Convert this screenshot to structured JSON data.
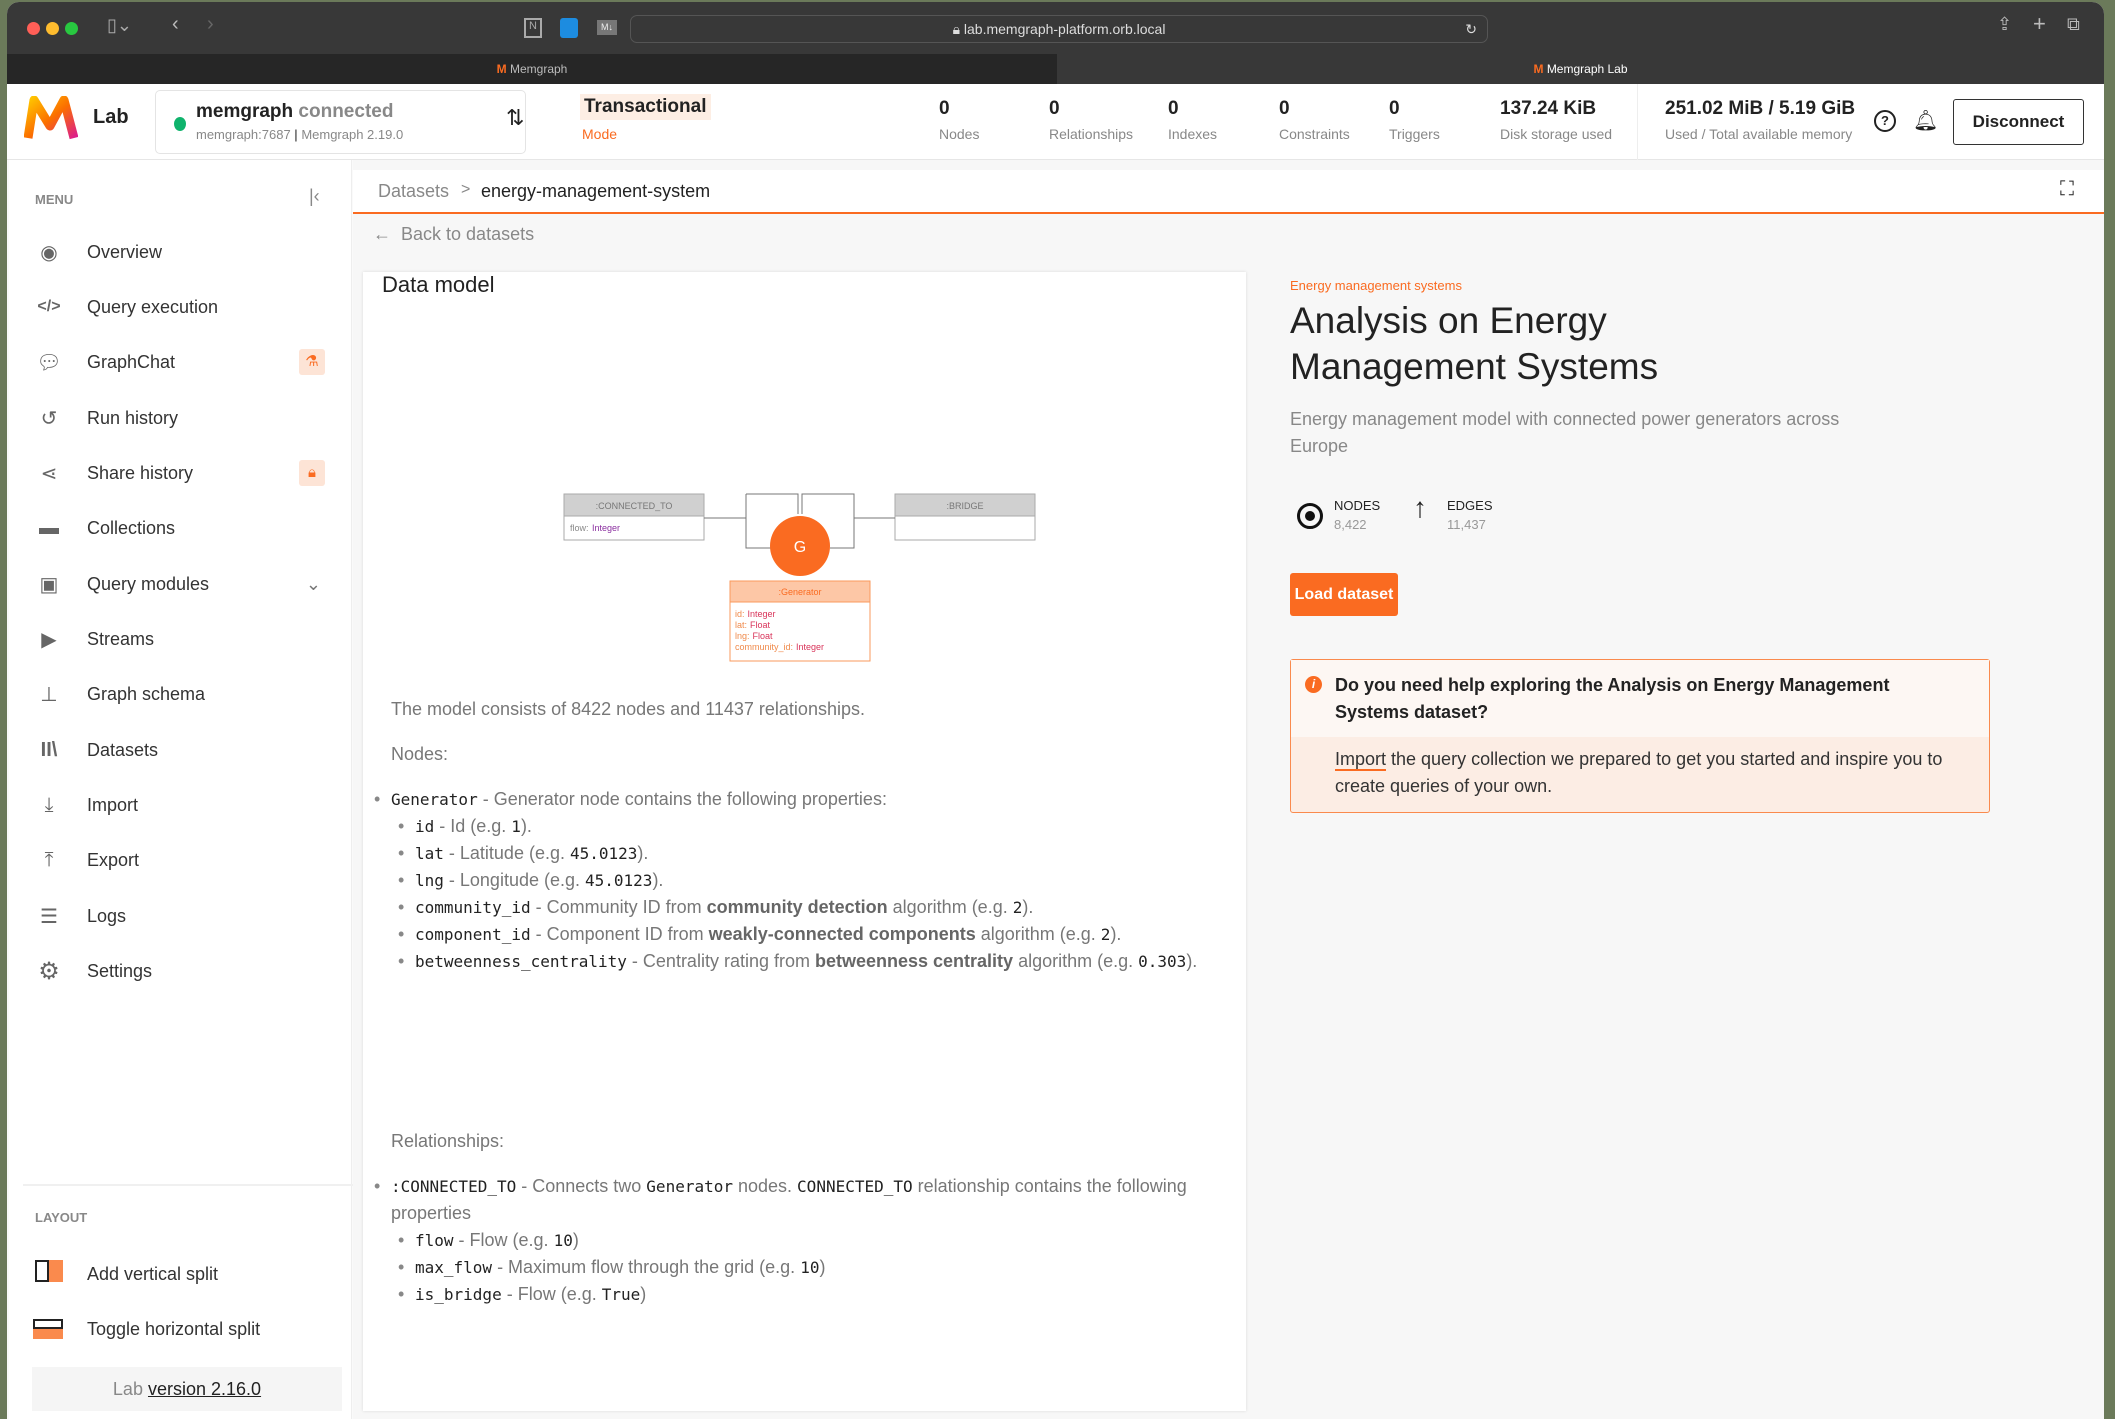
{
  "browser": {
    "url": "lab.memgraph-platform.orb.local",
    "tabs": [
      "Memgraph",
      "Memgraph Lab"
    ]
  },
  "header": {
    "logo_label": "Lab",
    "instance_name": "memgraph",
    "status": "connected",
    "host": "memgraph:7687",
    "version": "Memgraph 2.19.0",
    "mode_value": "Transactional",
    "mode_label": "Mode",
    "stats": [
      {
        "value": "0",
        "label": "Nodes"
      },
      {
        "value": "0",
        "label": "Relationships"
      },
      {
        "value": "0",
        "label": "Indexes"
      },
      {
        "value": "0",
        "label": "Constraints"
      },
      {
        "value": "0",
        "label": "Triggers"
      },
      {
        "value": "137.24 KiB",
        "label": "Disk storage used"
      },
      {
        "value": "251.02 MiB / 5.19 GiB",
        "label": "Used / Total available memory"
      }
    ],
    "disconnect_label": "Disconnect",
    "status_color": "#0fb36c"
  },
  "sidebar": {
    "menu_title": "MENU",
    "items": [
      {
        "label": "Overview",
        "icon": "eye-icon"
      },
      {
        "label": "Query execution",
        "icon": "code-icon"
      },
      {
        "label": "GraphChat",
        "icon": "chat-icon",
        "badge": "flask-icon"
      },
      {
        "label": "Run history",
        "icon": "history-icon"
      },
      {
        "label": "Share history",
        "icon": "share-icon",
        "badge": "lock-icon"
      },
      {
        "label": "Collections",
        "icon": "folder-icon"
      },
      {
        "label": "Query modules",
        "icon": "terminal-icon"
      },
      {
        "label": "Streams",
        "icon": "play-icon"
      },
      {
        "label": "Graph schema",
        "icon": "sitemap-icon"
      },
      {
        "label": "Datasets",
        "icon": "books-icon"
      },
      {
        "label": "Import",
        "icon": "download-icon"
      },
      {
        "label": "Export",
        "icon": "upload-icon"
      },
      {
        "label": "Logs",
        "icon": "list-icon"
      },
      {
        "label": "Settings",
        "icon": "gear-icon"
      }
    ],
    "layout_title": "LAYOUT",
    "layout_items": [
      "Add vertical split",
      "Toggle horizontal split"
    ],
    "version_prefix": "Lab",
    "version_link": "version 2.16.0"
  },
  "breadcrumb": {
    "root": "Datasets",
    "sep": ">",
    "current": "energy-management-system"
  },
  "back_label": "Back to datasets",
  "data_model": {
    "title": "Data model",
    "diagram": {
      "rel_box": ":CONNECTED_TO",
      "rel_prop": "flow:",
      "rel_type": "Integer",
      "bridge_box": ":BRIDGE",
      "node_letter": "G",
      "node_box": ":Generator",
      "node_props": [
        [
          "id:",
          "Integer"
        ],
        [
          "lat:",
          "Float"
        ],
        [
          "lng:",
          "Float"
        ],
        [
          "community_id:",
          "Integer"
        ]
      ]
    },
    "summary": "The model consists of 8422 nodes and 11437 relationships.",
    "nodes_heading": "Nodes:",
    "node": {
      "code": "Generator",
      "desc": " - Generator node contains the following properties:"
    },
    "node_props": [
      {
        "code": "id",
        "pre": " - Id (e.g. ",
        "ex": "1",
        "post": ")."
      },
      {
        "code": "lat",
        "pre": " - Latitude (e.g. ",
        "ex": "45.0123",
        "post": ")."
      },
      {
        "code": "lng",
        "pre": " - Longitude (e.g. ",
        "ex": "45.0123",
        "post": ")."
      },
      {
        "code": "community_id",
        "pre": " - Community ID from ",
        "bold": "community detection",
        "mid": " algorithm (e.g. ",
        "ex": "2",
        "post": ")."
      },
      {
        "code": "component_id",
        "pre": " - Component ID from ",
        "bold": "weakly-connected components",
        "mid": " algorithm (e.g. ",
        "ex": "2",
        "post": ")."
      },
      {
        "code": "betweenness_centrality",
        "pre": " - Centrality rating from ",
        "bold": "betweenness centrality",
        "mid": " algorithm (e.g. ",
        "ex": "0.303",
        "post": ")."
      }
    ],
    "rels_heading": "Relationships:",
    "rel": {
      "code": ":CONNECTED_TO",
      "d1": " - Connects two ",
      "code2": "Generator",
      "d2": " nodes. ",
      "code3": "CONNECTED_TO",
      "d3": " relationship contains the following properties"
    },
    "rel_props": [
      {
        "code": "flow",
        "pre": " - Flow (e.g. ",
        "ex": "10",
        "post": ")"
      },
      {
        "code": "max_flow",
        "pre": " - Maximum flow through the grid (e.g. ",
        "ex": "10",
        "post": ")"
      },
      {
        "code": "is_bridge",
        "pre": " - Flow (e.g. ",
        "ex": "True",
        "post": ")"
      }
    ]
  },
  "dataset": {
    "category": "Energy management systems",
    "title": "Analysis on Energy Management Systems",
    "description": "Energy management model with connected power generators across Europe",
    "nodes_label": "NODES",
    "nodes_value": "8,422",
    "edges_label": "EDGES",
    "edges_value": "11,437",
    "load_label": "Load dataset",
    "help_title": "Do you need help exploring the Analysis on Energy Management Systems dataset?",
    "help_link": "Import",
    "help_text": " the query collection we prepared to get you started and inspire you to create queries of your own."
  },
  "colors": {
    "accent": "#fa6b21"
  }
}
